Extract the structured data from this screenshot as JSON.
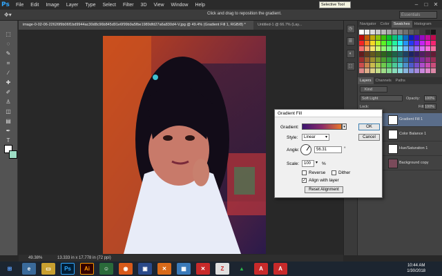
{
  "app": {
    "logo": "Ps"
  },
  "menubar": {
    "items": [
      "File",
      "Edit",
      "Image",
      "Layer",
      "Type",
      "Select",
      "Filter",
      "3D",
      "View",
      "Window",
      "Help"
    ]
  },
  "tooltip": "Selective Tool",
  "options_bar": {
    "hint": "Click and drag to reposition the gradient.",
    "workspace": "Essentials"
  },
  "doc_tabs": [
    {
      "label": "image-0-02-06-22626f9b06f1bd9944ac30d8c96b845d91e6f99b9a5fbe1989dfd27a6a830d4-V.jpg @ 49.4% (Gradient Fill 1, RGB/8) *"
    },
    {
      "label": "Untitled-1 @ 66.7% (Lay..."
    }
  ],
  "status": {
    "zoom": "49.38%",
    "doc_size": "13.333 in x 17.778 in (72 ppi)"
  },
  "right_panel": {
    "top_tabs": [
      "Navigator",
      "Color",
      "Swatches",
      "Histogram"
    ],
    "layer_tabs": [
      "Layers",
      "Channels",
      "Paths"
    ],
    "kind_label": "Kind",
    "blend_mode": "Soft Light",
    "opacity_label": "Opacity:",
    "opacity_value": "100%",
    "lock_label": "Lock:",
    "fill_label": "Fill:",
    "fill_value": "100%",
    "layers": [
      {
        "name": "Gradient Fill 1",
        "selected": true
      },
      {
        "name": "Color Balance 1",
        "selected": false
      },
      {
        "name": "Hue/Saturation 1",
        "selected": false
      },
      {
        "name": "Background copy",
        "selected": false
      }
    ]
  },
  "dialog": {
    "title": "Gradient Fill",
    "gradient_label": "Gradient:",
    "style_label": "Style:",
    "style_value": "Linear",
    "angle_label": "Angle:",
    "angle_value": "56.31",
    "angle_unit": "°",
    "scale_label": "Scale:",
    "scale_value": "100",
    "scale_unit": "%",
    "reverse_label": "Reverse",
    "reverse_checked": false,
    "dither_label": "Dither",
    "dither_checked": false,
    "align_label": "Align with layer",
    "align_checked": true,
    "reset_label": "Reset Alignment",
    "ok_label": "OK",
    "cancel_label": "Cancel",
    "gradient_colors": [
      "#3a1470",
      "#8a2a6a",
      "#e8782a"
    ]
  },
  "taskbar": {
    "time": "10:44 AM",
    "date": "1/30/2018",
    "ps_label": "Ps",
    "ai_label": "Ai"
  }
}
